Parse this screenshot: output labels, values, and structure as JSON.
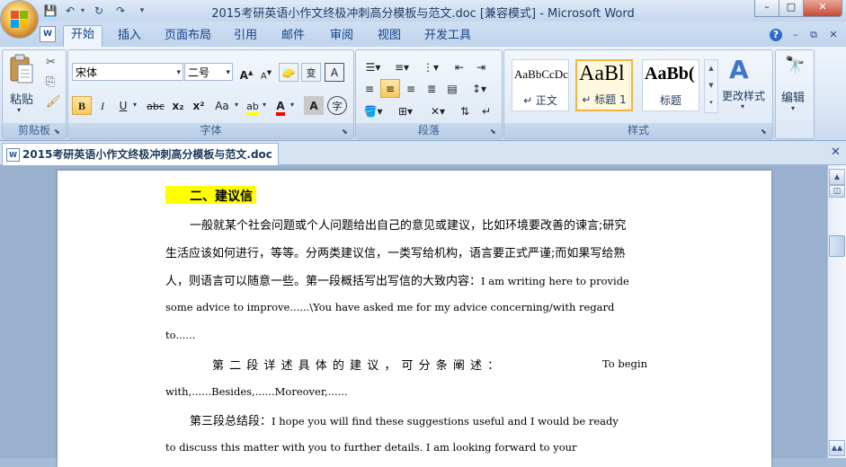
{
  "title_bar": {
    "title": "2015考研英语小作文终极冲刺高分模板与范文.doc [兼容模式] - Microsoft Word"
  },
  "quick_access": {
    "save_icon": "save-icon",
    "undo_icon": "undo-icon",
    "redo_icon": "redo-icon"
  },
  "ribbon_tabs": [
    {
      "label": "开始",
      "active": true
    },
    {
      "label": "插入"
    },
    {
      "label": "页面布局"
    },
    {
      "label": "引用"
    },
    {
      "label": "邮件"
    },
    {
      "label": "审阅"
    },
    {
      "label": "视图"
    },
    {
      "label": "开发工具"
    }
  ],
  "clipboard": {
    "group_label": "剪贴板",
    "paste_label": "粘贴"
  },
  "font": {
    "group_label": "字体",
    "font_name": "宋体",
    "font_size": "二号",
    "bold": "B",
    "italic": "I",
    "underline": "U",
    "strike": "abc",
    "subscript": "x₂",
    "superscript": "x²",
    "change_case": "Aa",
    "grow": "A",
    "shrink": "A",
    "char_border": "A",
    "enclose": "字",
    "phonetic": "变"
  },
  "paragraph": {
    "group_label": "段落"
  },
  "styles": {
    "group_label": "样式",
    "items": [
      {
        "sample": "AaBbCcDc",
        "name": "↵ 正文"
      },
      {
        "sample": "AaBl",
        "name": "↵ 标题 1"
      },
      {
        "sample": "AaBb(",
        "name": "标题"
      }
    ],
    "change_styles_label": "更改样式"
  },
  "editing": {
    "label": "编辑"
  },
  "document_tab": {
    "label": "2015考研英语小作文终极冲刺高分模板与范文.doc"
  },
  "document": {
    "heading": "二、建议信",
    "p1_l1": "一般就某个社会问题或个人问题给出自己的意见或建议，比如环境要改善的谏言;研究",
    "p1_l2": "生活应该如何进行，等等。分两类建议信，一类写给机构，语言要正式严谨;而如果写给熟",
    "p1_l3a": "人，则语言可以随意一些。第一段概括写出写信的大致内容：",
    "p1_l3b": "I am writing here to provide",
    "p1_l4": "some advice to improve......\\You have asked me for my advice concerning/with regard",
    "p1_l5": "to......",
    "p2_l1a": "第 二 段 详 述 具 体 的 建 议 ， 可 分 条 阐 述 ：",
    "p2_l1b": "To   begin",
    "p2_l2": "with,......Besides,......Moreover,......",
    "p3_l1a": "第三段总结段：",
    "p3_l1b": "I hope you will find these suggestions useful and I would be ready",
    "p3_l2": "to discuss this matter with you to further details. I am looking forward to your"
  },
  "colors": {
    "highlight": "#ffff00",
    "font_color": "#ff0000",
    "accent": "#15428b"
  }
}
